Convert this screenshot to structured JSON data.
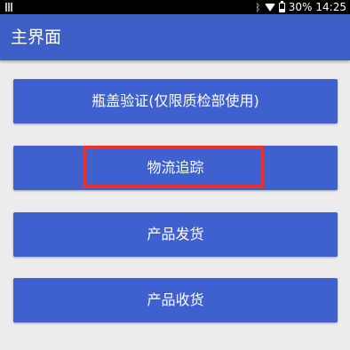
{
  "status_bar": {
    "battery_percent": "30%",
    "battery_level": 0.3,
    "time": "14:25",
    "icons": [
      "notification-icon",
      "bluetooth-icon",
      "wifi-icon",
      "battery-icon"
    ]
  },
  "app_bar": {
    "title": "主界面"
  },
  "buttons": [
    {
      "label": "瓶盖验证(仅限质检部使用)"
    },
    {
      "label": "物流追踪"
    },
    {
      "label": "产品发货"
    },
    {
      "label": "产品收货"
    }
  ],
  "colors": {
    "primary": "#3f5fc8",
    "button": "#3f61cf",
    "background": "#ececec",
    "highlight": "#e8322d"
  }
}
